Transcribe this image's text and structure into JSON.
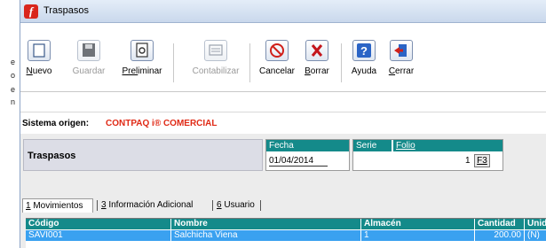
{
  "window": {
    "title": "Traspasos",
    "app_icon_glyph": "f"
  },
  "toolbar": {
    "buttons": [
      {
        "key": "N",
        "rest": "uevo",
        "icon": "new-document-icon",
        "enabled": true
      },
      {
        "key": "",
        "rest": "Guardar",
        "icon": "save-icon",
        "enabled": false
      },
      {
        "key": "Prel",
        "rest": "iminar",
        "icon": "preview-icon",
        "enabled": true
      },
      {
        "key": "",
        "rest": "Contabilizar",
        "icon": "accounting-icon",
        "enabled": false
      },
      {
        "key": "Cancelar",
        "rest": "",
        "icon": "cancel-icon",
        "enabled": true
      },
      {
        "key": "B",
        "rest": "orrar",
        "icon": "delete-icon",
        "enabled": true
      },
      {
        "key": "Ayuda",
        "rest": "",
        "icon": "help-icon",
        "enabled": true
      },
      {
        "key": "C",
        "rest": "errar",
        "icon": "exit-icon",
        "enabled": true
      }
    ]
  },
  "origin": {
    "label": "Sistema origen:",
    "value": "CONTPAQ i® COMERCIAL"
  },
  "header": {
    "section_title": "Traspasos",
    "fecha_label": "Fecha",
    "fecha_value": "01/04/2014",
    "serie_label": "Serie",
    "folio_label": "Folio",
    "folio_value": "1",
    "f3_label": "F3"
  },
  "tabs": [
    {
      "num": "1",
      "label": " Movimientos"
    },
    {
      "num": "3",
      "label": " Información Adicional"
    },
    {
      "num": "6",
      "label": " Usuario"
    }
  ],
  "grid": {
    "columns": [
      "Código",
      "Nombre",
      "Almacén",
      "Cantidad",
      "Unid"
    ],
    "rows": [
      {
        "codigo": "SAVI001",
        "nombre": "Salchicha Viena",
        "almacen": "1",
        "cantidad": "200.00",
        "unidad": "(N)"
      }
    ]
  },
  "colors": {
    "grid_header": "#148a8a",
    "selected_row": "#3aa1f0",
    "origin_value": "#e02a16"
  }
}
